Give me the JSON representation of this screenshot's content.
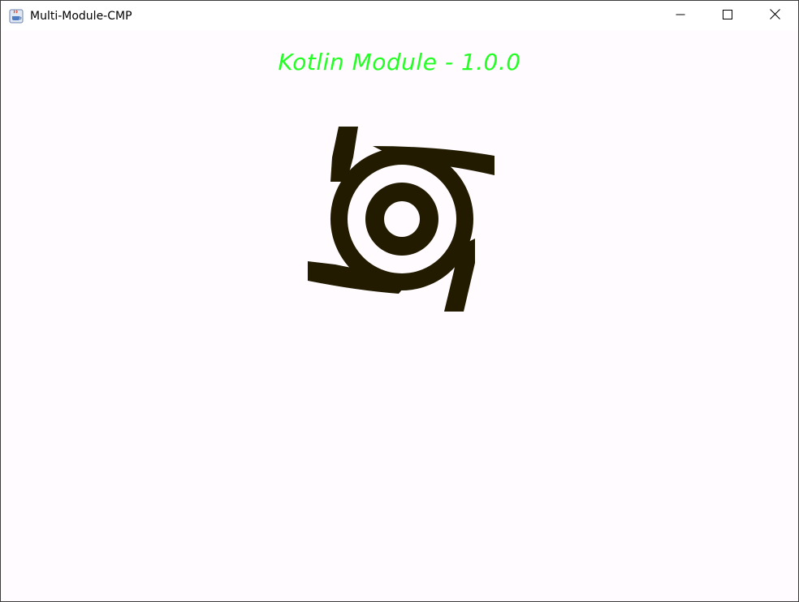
{
  "window": {
    "title": "Multi-Module-CMP",
    "app_icon": "java-app-icon",
    "controls": {
      "minimize_icon": "minimize-icon",
      "maximize_icon": "maximize-icon",
      "close_icon": "close-icon"
    }
  },
  "content": {
    "headline": "Kotlin Module - 1.0.0",
    "logo_icon": "swirl-logo-icon"
  },
  "colors": {
    "headline": "#22ff22",
    "background": "#fffbff",
    "logo": "#221b00",
    "titlebar": "#ffffff"
  }
}
